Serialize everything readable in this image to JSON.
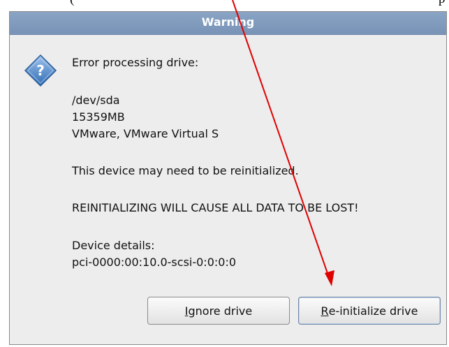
{
  "document": {
    "fragment": "(",
    "fragment_right": "p"
  },
  "dialog": {
    "title": "Warning",
    "icon": "question-icon",
    "colors": {
      "titlebar": "#7f9abc",
      "background": "#ededed",
      "arrow": "#e00000"
    },
    "message": "Error processing drive:",
    "device_path": "/dev/sda",
    "device_size": "15359MB",
    "device_model": "VMware, VMware Virtual S",
    "notice": "This device may need to be reinitialized.",
    "warning": "REINITIALIZING WILL CAUSE ALL DATA TO BE LOST!",
    "details_label": "Device details:",
    "details_value": "pci-0000:00:10.0-scsi-0:0:0:0",
    "buttons": {
      "ignore": {
        "mnemonic": "I",
        "rest": "gnore drive"
      },
      "reinit": {
        "mnemonic": "R",
        "rest": "e-initialize drive"
      }
    }
  }
}
